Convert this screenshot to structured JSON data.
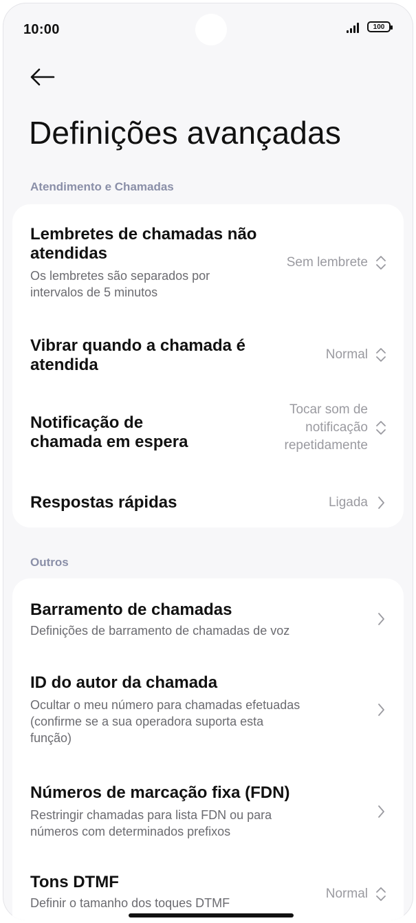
{
  "status": {
    "time": "10:00",
    "battery": "100"
  },
  "header": {
    "title": "Definições avançadas"
  },
  "sections": [
    {
      "label": "Atendimento e Chamadas",
      "items": [
        {
          "title_line1": "Lembretes de chamadas não",
          "title_line2": "atendidas",
          "subtitle_line1": "Os lembretes são separados por",
          "subtitle_line2": "intervalos de 5 minutos",
          "value": "Sem lembrete",
          "control": "selector"
        },
        {
          "title_line1": "Vibrar quando a chamada é",
          "title_line2": "atendida",
          "value": "Normal",
          "control": "selector"
        },
        {
          "title_line1": "Notificação de",
          "title_line2": "chamada em espera",
          "value_line1": "Tocar som de",
          "value_line2": "notificação",
          "value_line3": "repetidamente",
          "control": "selector"
        },
        {
          "title_line1": "Respostas rápidas",
          "value": "Ligada",
          "control": "link"
        }
      ]
    },
    {
      "label": "Outros",
      "items": [
        {
          "title_line1": "Barramento de chamadas",
          "subtitle_line1": "Definições de barramento de chamadas de voz",
          "control": "link"
        },
        {
          "title_line1": "ID do autor da chamada",
          "subtitle_line1": "Ocultar o meu número para chamadas efetuadas",
          "subtitle_line2": "(confirme se a sua operadora suporta esta",
          "subtitle_line3": "função)",
          "control": "link"
        },
        {
          "title_line1": "Números de marcação fixa (FDN)",
          "subtitle_line1": "Restringir chamadas para lista FDN ou para",
          "subtitle_line2": "números com determinados prefixos",
          "control": "link"
        },
        {
          "title_line1": "Tons DTMF",
          "subtitle_line1": "Definir o tamanho dos toques DTMF",
          "value": "Normal",
          "control": "selector"
        }
      ]
    }
  ],
  "colors": {
    "background": "#f7f7f9",
    "card": "#ffffff",
    "section_label": "#8a8fa8",
    "value_text": "#9a9aa0",
    "subtitle_text": "#6b6b70"
  },
  "icons": {
    "back": "arrow-left-icon",
    "selector": "chevron-up-down-icon",
    "link": "chevron-right-icon"
  }
}
